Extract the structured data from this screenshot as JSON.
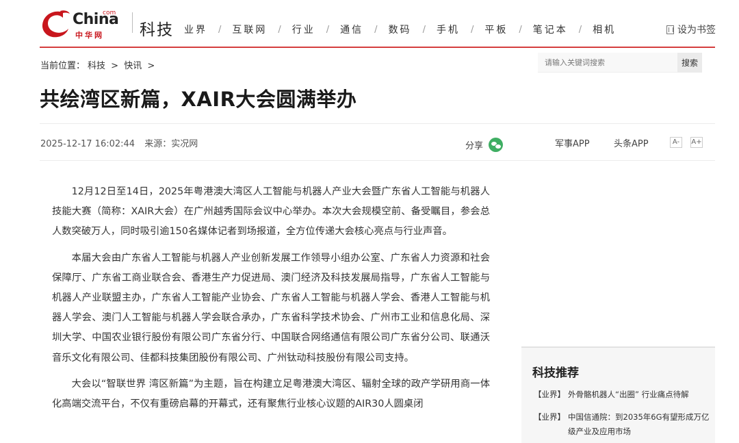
{
  "logo": {
    "word": "China",
    "com": "com",
    "cn": "中华网"
  },
  "channel": "科技",
  "nav": [
    "业界",
    "互联网",
    "行业",
    "通信",
    "数码",
    "手机",
    "平板",
    "笔记本",
    "相机"
  ],
  "nav_separator": "/",
  "bookmark_label": "设为书签",
  "breadcrumb": {
    "prefix": "当前位置：",
    "items": [
      "科技",
      "快讯"
    ],
    "separator": ">"
  },
  "search": {
    "placeholder": "请输入关键词搜索",
    "button": "搜索"
  },
  "article": {
    "title": "共绘湾区新篇，XAIR大会圆满举办",
    "date": "2025-12-17 16:02:44",
    "source": "来源：实况网",
    "share_label": "分享",
    "app_links": [
      "军事APP",
      "头条APP"
    ],
    "font_buttons": [
      "A-",
      "A+"
    ],
    "paragraphs": [
      "12月12日至14日，2025年粤港澳大湾区人工智能与机器人产业大会暨广东省人工智能与机器人技能大赛（简称：XAIR大会）在广州越秀国际会议中心举办。本次大会规模空前、备受瞩目，参会总人数突破万人，同时吸引逾150名媒体记者到场报道，全方位传递大会核心亮点与行业声音。",
      "本届大会由广东省人工智能与机器人产业创新发展工作领导小组办公室、广东省人力资源和社会保障厅、广东省工商业联合会、香港生产力促进局、澳门经济及科技发展局指导，广东省人工智能与机器人产业联盟主办，广东省人工智能产业协会、广东省人工智能与机器人学会、香港人工智能与机器人学会、澳门人工智能与机器人学会联合承办，广东省科学技术协会、广州市工业和信息化局、深圳大学、中国农业银行股份有限公司广东省分行、中国联合网络通信有限公司广东省分公司、联通沃音乐文化有限公司、佳都科技集团股份有限公司、广州钛动科技股份有限公司支持。",
      "大会以“智联世界 湾区新篇”为主题，旨在构建立足粤港澳大湾区、辐射全球的政产学研用商一体化高端交流平台，不仅有重磅启幕的开幕式，还有聚焦行业核心议题的AIR30人圆桌闭"
    ]
  },
  "recommend": {
    "title": "科技推荐",
    "items": [
      {
        "tag": "【业界】",
        "text": "外骨骼机器人“出圈” 行业痛点待解"
      },
      {
        "tag": "【业界】",
        "text": "中国信通院：到2035年6G有望形成万亿级产业及应用市场"
      }
    ]
  },
  "colors": {
    "brand_red": "#c8161d",
    "header_line": "#d43d3d",
    "wechat_green": "#3fae63"
  }
}
